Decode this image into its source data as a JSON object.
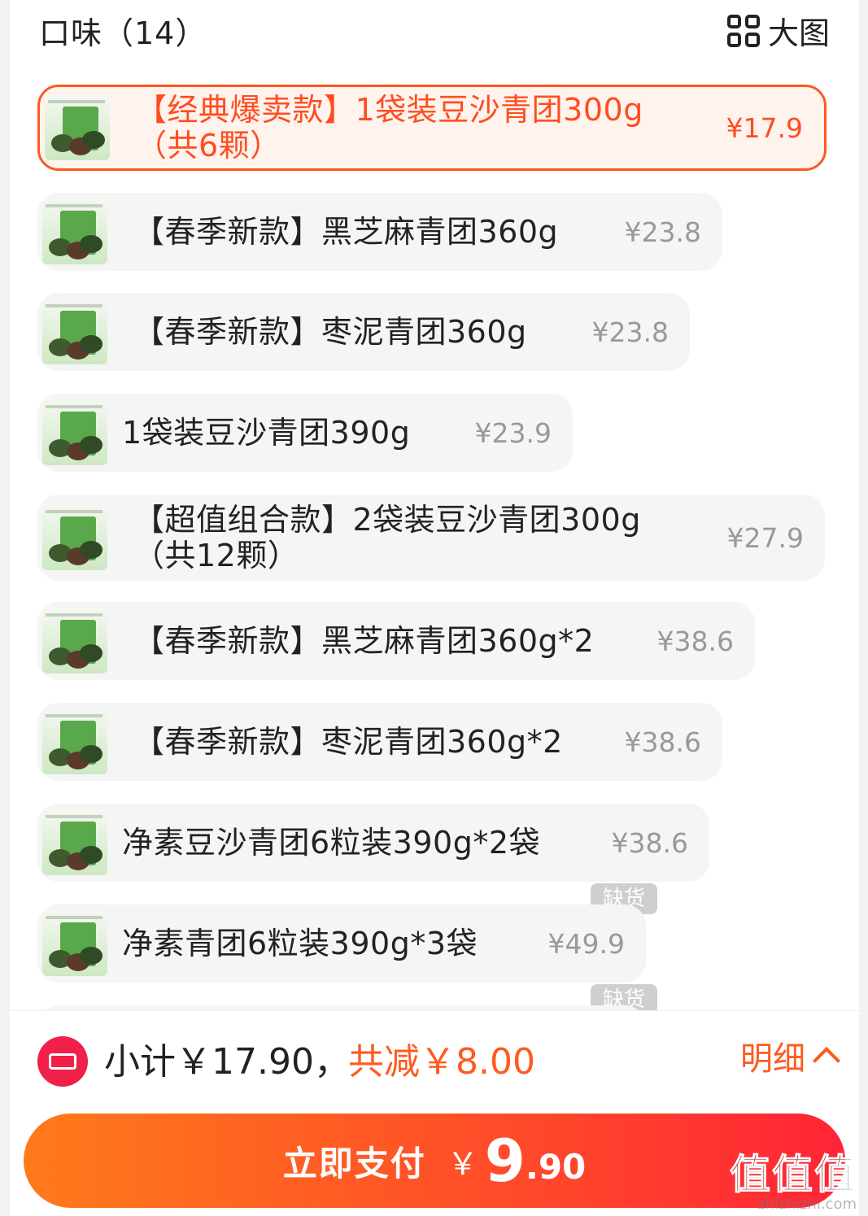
{
  "header": {
    "title": "口味（14）",
    "big_image_label": "大图"
  },
  "options": [
    {
      "name": "【经典爆卖款】1袋装豆沙青团300g（共6颗）",
      "price": "¥17.9",
      "selected": true
    },
    {
      "name": "【春季新款】黑芝麻青团360g",
      "price": "¥23.8"
    },
    {
      "name": "【春季新款】枣泥青团360g",
      "price": "¥23.8"
    },
    {
      "name": "1袋装豆沙青团390g",
      "price": "¥23.9"
    },
    {
      "name": "【超值组合款】2袋装豆沙青团300g（共12颗）",
      "price": "¥27.9"
    },
    {
      "name": "【春季新款】黑芝麻青团360g*2",
      "price": "¥38.6"
    },
    {
      "name": "【春季新款】枣泥青团360g*2",
      "price": "¥38.6"
    },
    {
      "name": "净素豆沙青团6粒装390g*2袋",
      "price": "¥38.6"
    },
    {
      "name": "净素青团6粒装390g*3袋",
      "price": "¥49.9"
    }
  ],
  "badges": [
    "缺货",
    "缺货"
  ],
  "footer": {
    "subtotal": "小计￥17.90，",
    "reduce": "共减￥8.00",
    "detail_label": "明细",
    "pay_label": "立即支付",
    "pay_currency": "￥",
    "pay_int": "9",
    "pay_dec": ".90"
  },
  "watermark": {
    "big": "值值值",
    "small": "zhizhizhi.com"
  },
  "colors": {
    "accent": "#ff5722",
    "pay_start": "#ff7a1a",
    "pay_end": "#ff2436",
    "coupon": "#f0204b"
  }
}
